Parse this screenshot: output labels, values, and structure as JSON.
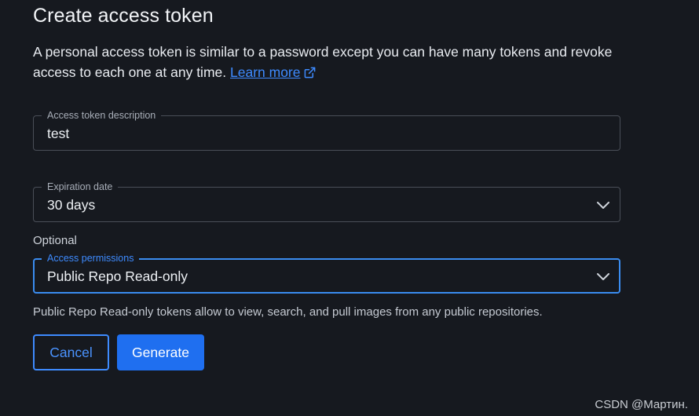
{
  "dialog": {
    "title": "Create access token",
    "description": "A personal access token is similar to a password except you can have many tokens and revoke access to each one at any time.",
    "learn_more": "Learn more"
  },
  "token_description": {
    "label": "Access token description",
    "value": "test"
  },
  "expiration": {
    "label": "Expiration date",
    "value": "30 days"
  },
  "optional_label": "Optional",
  "permissions": {
    "label": "Access permissions",
    "value": "Public Repo Read-only",
    "helper": "Public Repo Read-only tokens allow to view, search, and pull images from any public repositories."
  },
  "buttons": {
    "cancel": "Cancel",
    "generate": "Generate"
  },
  "watermark": "CSDN @Мартин.",
  "icons": {
    "external": "external-link-icon",
    "chevron": "chevron-down-icon"
  },
  "colors": {
    "background": "#16191f",
    "accent": "#3e8bff",
    "primary_button": "#1f6ff0"
  }
}
